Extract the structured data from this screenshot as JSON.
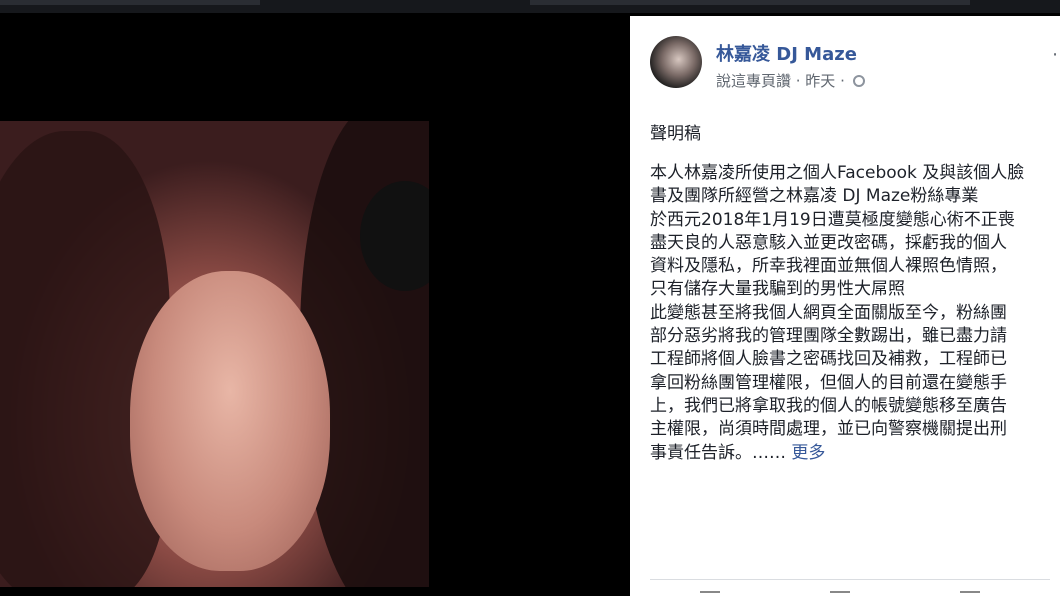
{
  "post": {
    "page_name": "林嘉凌 DJ Maze",
    "meta_text": "說這專頁讚 · 昨天 ·",
    "heading": "聲明稿",
    "body_lines": [
      "本人林嘉凌所使用之個人Facebook 及與該個人臉",
      "書及團隊所經營之林嘉凌 DJ Maze粉絲專業",
      "於西元2018年1月19日遭莫極度變態心術不正喪",
      "盡天良的人惡意駭入並更改密碼，採虧我的個人",
      "資料及隱私，所幸我裡面並無個人裸照色情照，",
      "只有儲存大量我騙到的男性大屌照",
      "此變態甚至將我個人網頁全面關版至今，粉絲團",
      "部分惡劣將我的管理團隊全數踢出，雖已盡力請",
      "工程師將個人臉書之密碼找回及補救，工程師已",
      "拿回粉絲團管理權限，但個人的目前還在變態手",
      "上，我們已將拿取我的個人的帳號變態移至廣告",
      "主權限，尚須時間處理，並已向警察機關提出刑"
    ],
    "last_line": "事責任告訴。……",
    "see_more": "更多"
  },
  "icons": {
    "globe": "globe-icon",
    "more": "more-options-icon"
  },
  "colors": {
    "link": "#365899",
    "text": "#1d2129",
    "meta": "#606770",
    "background": "#000000"
  }
}
